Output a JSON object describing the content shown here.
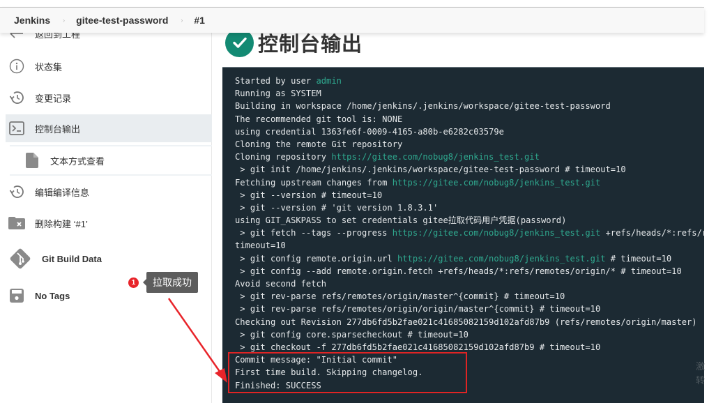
{
  "breadcrumb": {
    "items": [
      "Jenkins",
      "gitee-test-password",
      "#1"
    ],
    "separator": "›"
  },
  "sidebar": {
    "items": [
      {
        "label": "返回到工程",
        "icon": "arrow-left-icon"
      },
      {
        "label": "状态集",
        "icon": "info-icon"
      },
      {
        "label": "变更记录",
        "icon": "history-icon"
      },
      {
        "label": "控制台输出",
        "icon": "terminal-icon",
        "active": true
      },
      {
        "label": "文本方式查看",
        "icon": "document-icon",
        "sub": true
      },
      {
        "label": "编辑编译信息",
        "icon": "history-icon"
      },
      {
        "label": "删除构建 ‘#1’",
        "icon": "folder-delete-icon"
      },
      {
        "label": "Git Build Data",
        "icon": "git-icon"
      },
      {
        "label": "No Tags",
        "icon": "save-icon"
      }
    ]
  },
  "page": {
    "title": "控制台输出",
    "status": "success",
    "accent_color": "#138a73"
  },
  "console": {
    "lines": [
      [
        {
          "t": "Started by user "
        },
        {
          "t": "admin",
          "link": true
        }
      ],
      [
        {
          "t": "Running as SYSTEM"
        }
      ],
      [
        {
          "t": "Building in workspace /home/jenkins/.jenkins/workspace/gitee-test-password"
        }
      ],
      [
        {
          "t": "The recommended git tool is: NONE"
        }
      ],
      [
        {
          "t": "using credential 1363fe6f-0009-4165-a80b-e6282c03579e"
        }
      ],
      [
        {
          "t": "Cloning the remote Git repository"
        }
      ],
      [
        {
          "t": "Cloning repository "
        },
        {
          "t": "https://gitee.com/nobug8/jenkins_test.git",
          "link": true
        }
      ],
      [
        {
          "t": " > git init /home/jenkins/.jenkins/workspace/gitee-test-password # timeout=10"
        }
      ],
      [
        {
          "t": "Fetching upstream changes from "
        },
        {
          "t": "https://gitee.com/nobug8/jenkins_test.git",
          "link": true
        }
      ],
      [
        {
          "t": " > git --version # timeout=10"
        }
      ],
      [
        {
          "t": " > git --version # 'git version 1.8.3.1'"
        }
      ],
      [
        {
          "t": "using GIT_ASKPASS to set credentials gitee拉取代码用户凭据(password)"
        }
      ],
      [
        {
          "t": " > git fetch --tags --progress "
        },
        {
          "t": "https://gitee.com/nobug8/jenkins_test.git",
          "link": true
        },
        {
          "t": " +refs/heads/*:refs/remotes/origin/*"
        }
      ],
      [
        {
          "t": "timeout=10"
        }
      ],
      [
        {
          "t": " > git config remote.origin.url "
        },
        {
          "t": "https://gitee.com/nobug8/jenkins_test.git",
          "link": true
        },
        {
          "t": " # timeout=10"
        }
      ],
      [
        {
          "t": " > git config --add remote.origin.fetch +refs/heads/*:refs/remotes/origin/* # timeout=10"
        }
      ],
      [
        {
          "t": "Avoid second fetch"
        }
      ],
      [
        {
          "t": " > git rev-parse refs/remotes/origin/master^{commit} # timeout=10"
        }
      ],
      [
        {
          "t": " > git rev-parse refs/remotes/origin/origin/master^{commit} # timeout=10"
        }
      ],
      [
        {
          "t": "Checking out Revision 277db6fd5b2fae021c41685082159d102afd87b9 (refs/remotes/origin/master)"
        }
      ],
      [
        {
          "t": " > git config core.sparsecheckout # timeout=10"
        }
      ],
      [
        {
          "t": " > git checkout -f 277db6fd5b2fae021c41685082159d102afd87b9 # timeout=10"
        }
      ],
      [
        {
          "t": "Commit message: \"Initial commit\""
        }
      ],
      [
        {
          "t": "First time build. Skipping changelog."
        }
      ],
      [
        {
          "t": "Finished: SUCCESS"
        }
      ]
    ]
  },
  "annotation": {
    "badge": "1",
    "tooltip": "拉取成功",
    "highlight_color": "#e02424"
  },
  "watermark": {
    "line1": "激",
    "line2": "转"
  }
}
